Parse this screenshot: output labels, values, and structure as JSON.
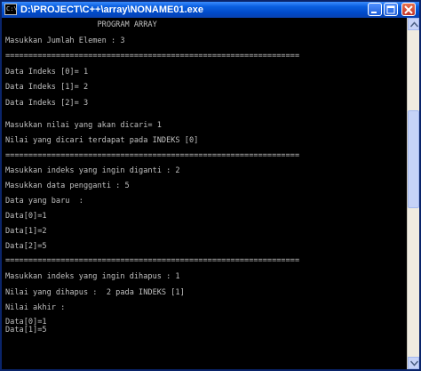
{
  "window": {
    "title": "D:\\PROJECT\\C++\\array\\NONAME01.exe",
    "icon_glyph": "C:\\"
  },
  "console": {
    "lines": [
      "                    PROGRAM ARRAY",
      "Masukkan Jumlah Elemen : 3",
      "================================================================",
      "Data Indeks [0]= 1",
      "Data Indeks [1]= 2",
      "Data Indeks [2]= 3",
      "Masukkan nilai yang akan dicari= 1",
      "Nilai yang dicari terdapat pada INDEKS [0]",
      "================================================================",
      "Masukkan indeks yang ingin diganti : 2",
      "Masukkan data pengganti : 5",
      "Data yang baru  :",
      "Data[0]=1",
      "Data[1]=2",
      "Data[2]=5",
      "================================================================",
      "Masukkan indeks yang ingin dihapus : 1",
      "Nilai yang dihapus :  2 pada INDEKS [1]",
      "Nilai akhir :",
      "Data[0]=1",
      "Data[1]=5"
    ]
  },
  "icons": {
    "minimize": "minimize-icon",
    "maximize": "maximize-icon",
    "close": "close-icon",
    "scroll_up": "arrow-up-icon",
    "scroll_down": "arrow-down-icon"
  },
  "colors": {
    "title_bar": "#0054e3",
    "console_bg": "#000000",
    "console_text": "#c0c0c0",
    "close_button": "#c2352a"
  }
}
